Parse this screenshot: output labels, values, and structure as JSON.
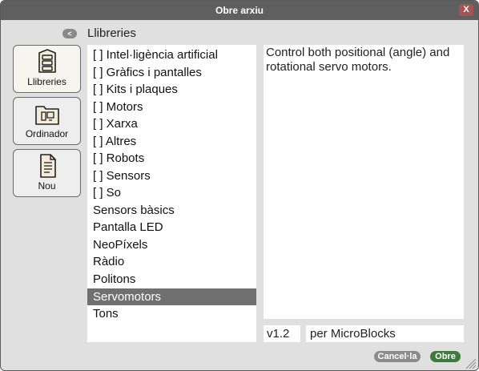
{
  "dialog": {
    "title": "Obre arxiu",
    "close_label": "X",
    "back_label": "<",
    "current_folder": "Llibreries"
  },
  "sidebar": {
    "buttons": [
      {
        "label": "Llibreries",
        "icon": "library-icon",
        "selected": true
      },
      {
        "label": "Ordinador",
        "icon": "computer-folder-icon",
        "selected": false
      },
      {
        "label": "Nou",
        "icon": "new-file-icon",
        "selected": false
      }
    ]
  },
  "list": {
    "items": [
      "[ ] Intel·ligència artificial",
      "[ ] Gràfics i pantalles",
      "[ ] Kits i plaques",
      "[ ] Motors",
      "[ ] Xarxa",
      "[ ] Altres",
      "[ ] Robots",
      "[ ] Sensors",
      "[ ] So",
      "Sensors bàsics",
      "Pantalla LED",
      "NeoPíxels",
      "Ràdio",
      "Politons",
      "Servomotors",
      "Tons"
    ],
    "selected_item": "Servomotors"
  },
  "details": {
    "description": "Control both positional (angle) and rotational servo motors.",
    "version": "v1.2",
    "author": "per MicroBlocks"
  },
  "footer": {
    "cancel_label": "Cancel·la",
    "open_label": "Obre"
  },
  "colors": {
    "titlebar": "#5f5f5f",
    "selection": "#707070",
    "open_button": "#3f7a3f",
    "cancel_button": "#8c8c8c",
    "close_button": "#a35555"
  }
}
